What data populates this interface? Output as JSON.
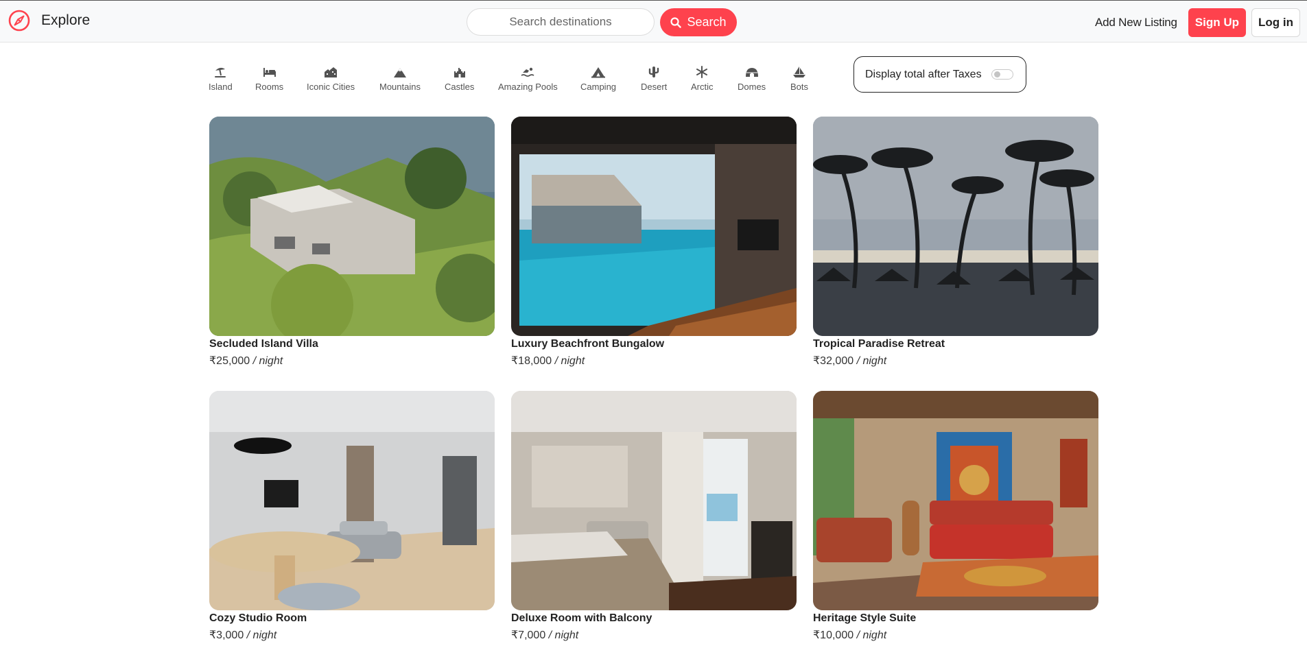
{
  "nav": {
    "brand": "Explore",
    "search_placeholder": "Search destinations",
    "search_label": "Search",
    "add_listing": "Add New Listing",
    "signup": "Sign Up",
    "login": "Log in"
  },
  "filters": [
    {
      "label": "Island",
      "icon": "umbrella-beach-icon"
    },
    {
      "label": "Rooms",
      "icon": "bed-icon"
    },
    {
      "label": "Iconic Cities",
      "icon": "city-icon"
    },
    {
      "label": "Mountains",
      "icon": "mountain-icon"
    },
    {
      "label": "Castles",
      "icon": "castle-icon"
    },
    {
      "label": "Amazing Pools",
      "icon": "swimmer-icon"
    },
    {
      "label": "Camping",
      "icon": "campground-icon"
    },
    {
      "label": "Desert",
      "icon": "cactus-icon"
    },
    {
      "label": "Arctic",
      "icon": "snowflake-icon"
    },
    {
      "label": "Domes",
      "icon": "igloo-icon"
    },
    {
      "label": "Bots",
      "icon": "sailboat-icon"
    }
  ],
  "tax_toggle": {
    "label": "Display total after Taxes",
    "on": false
  },
  "listings": [
    {
      "title": "Secluded Island Villa",
      "price": "₹25,000",
      "per": " / night"
    },
    {
      "title": "Luxury Beachfront Bungalow",
      "price": "₹18,000",
      "per": " / night"
    },
    {
      "title": "Tropical Paradise Retreat",
      "price": "₹32,000",
      "per": " / night"
    },
    {
      "title": "Cozy Studio Room",
      "price": "₹3,000",
      "per": " / night"
    },
    {
      "title": "Deluxe Room with Balcony",
      "price": "₹7,000",
      "per": " / night"
    },
    {
      "title": "Heritage Style Suite",
      "price": "₹10,000",
      "per": " / night"
    }
  ],
  "colors": {
    "accent": "#fe424d",
    "text": "#222222",
    "navbar_bg": "#f8f9fa"
  }
}
